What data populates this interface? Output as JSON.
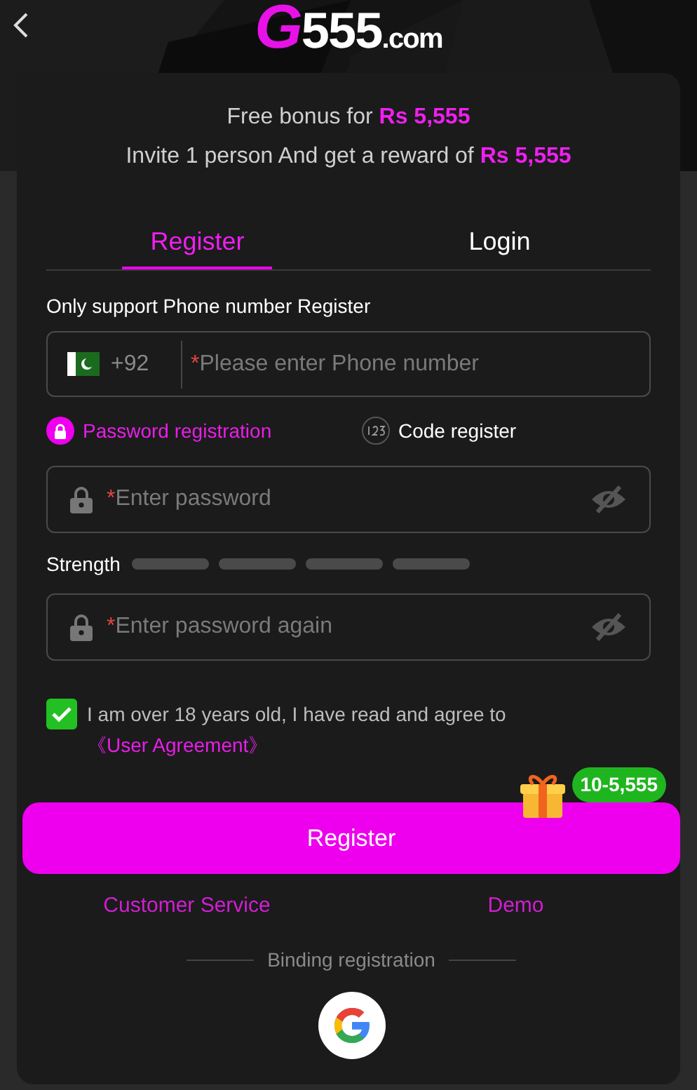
{
  "header": {
    "logo": "G555.com"
  },
  "bonus": {
    "line_1": "Free bonus for **Rs 5,555**",
    "line_2": "Invite 1 person And get a reward of **Rs 5,555**"
  },
  "tabs": [
    {
      "label": "Register",
      "selected": true
    },
    {
      "label": "Login",
      "selected": false
    }
  ],
  "form_title": "Only support Phone number Register",
  "phone_field": {
    "country_code": "+92",
    "required_mark": "*",
    "placeholder": "Please enter Phone number"
  },
  "modes": [
    {
      "kind": "password",
      "label": "Password registration",
      "selected": true
    },
    {
      "kind": "code",
      "label": "Code register",
      "selected": false
    }
  ],
  "password_field": {
    "required_mark": "*",
    "placeholder": "Enter password"
  },
  "strength": {
    "label": "Strength"
  },
  "password_again_field": {
    "required_mark": "*",
    "placeholder": "Enter password again"
  },
  "agreement": {
    "checked": true,
    "text": "I am over 18 years old, I have read and agree to",
    "link": "《User Agreement》"
  },
  "reward_badge": "10-5,555",
  "register_button": "Register",
  "links": [
    "Customer Service",
    "Demo"
  ],
  "binding_label": "Binding registration"
}
